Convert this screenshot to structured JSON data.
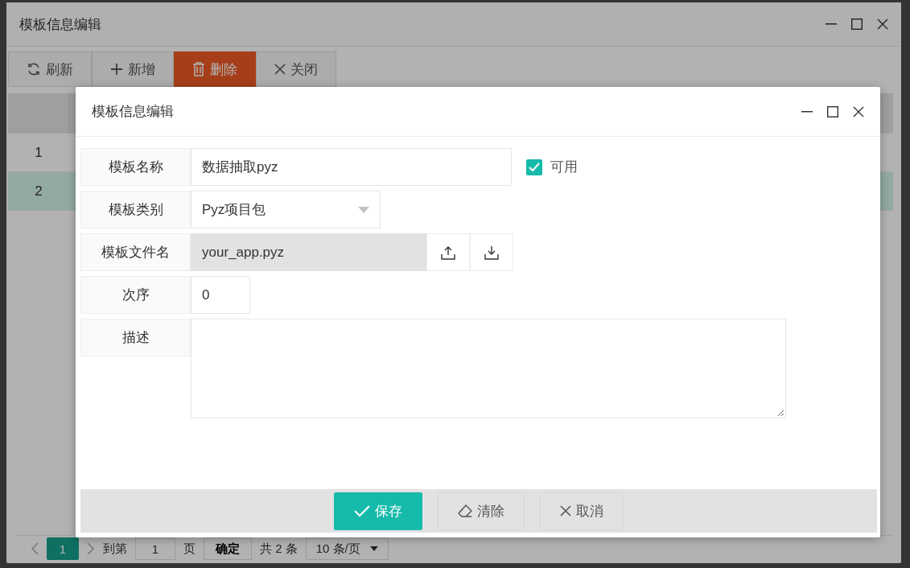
{
  "background_window": {
    "title": "模板信息编辑",
    "toolbar": [
      {
        "label": "刷新",
        "kind": "refresh"
      },
      {
        "label": "新增",
        "kind": "add"
      },
      {
        "label": "删除",
        "kind": "delete"
      },
      {
        "label": "关闭",
        "kind": "close"
      }
    ],
    "table": {
      "rows": [
        {
          "index": "1",
          "selected": false
        },
        {
          "index": "2",
          "selected": true
        }
      ]
    },
    "pagination": {
      "pages": [
        {
          "label": "1",
          "selected": true
        }
      ],
      "goto_label": "到第",
      "goto_value": "1",
      "page_unit": "页",
      "confirm": "确定",
      "total": "共 2 条",
      "page_size": "10 条/页"
    }
  },
  "dialog": {
    "title": "模板信息编辑",
    "fields": [
      {
        "kind": "text",
        "label": "模板名称",
        "value": "数据抽取pyz",
        "checkbox": {
          "label": "可用",
          "checked": true
        }
      },
      {
        "kind": "select",
        "label": "模板类别",
        "value": "Pyz项目包"
      },
      {
        "kind": "file",
        "label": "模板文件名",
        "value": "your_app.pyz"
      },
      {
        "kind": "number",
        "label": "次序",
        "value": "0"
      },
      {
        "kind": "textarea",
        "label": "描述"
      }
    ],
    "buttons": [
      {
        "label": "保存",
        "kind": "save"
      },
      {
        "label": "清除",
        "kind": "clear"
      },
      {
        "label": "取消",
        "kind": "cancel"
      }
    ]
  }
}
